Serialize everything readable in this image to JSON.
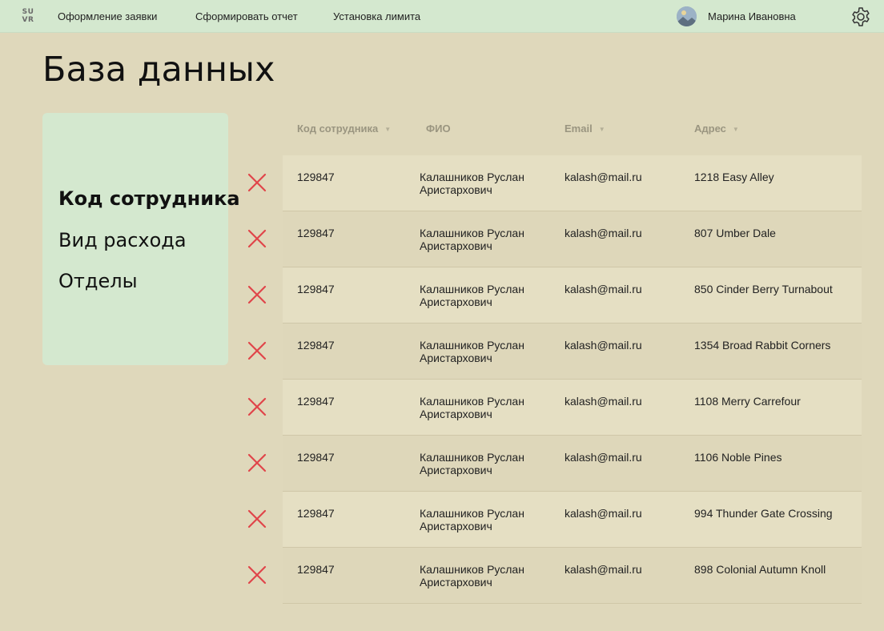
{
  "app": {
    "logo_text_top": "SU",
    "logo_text_bottom": "VR"
  },
  "nav": {
    "items": [
      {
        "label": "Оформление заявки"
      },
      {
        "label": "Сформировать отчет"
      },
      {
        "label": "Установка лимита"
      }
    ],
    "user_name": "Марина Ивановна"
  },
  "page_title": "База данных",
  "sidebar": {
    "items": [
      {
        "label": "Код сотрудника",
        "active": true
      },
      {
        "label": "Вид расхода",
        "active": false
      },
      {
        "label": "Отделы",
        "active": false
      }
    ]
  },
  "table": {
    "columns": [
      {
        "label": "Код сотрудника"
      },
      {
        "label": "ФИО"
      },
      {
        "label": "Email"
      },
      {
        "label": "Адрес"
      }
    ],
    "rows": [
      {
        "id": "129847",
        "name_line1": "Калашников Руслан",
        "name_line2": "Аристархович",
        "email": "kalash@mail.ru",
        "address": "1218 Easy Alley"
      },
      {
        "id": "129847",
        "name_line1": "Калашников Руслан",
        "name_line2": "Аристархович",
        "email": "kalash@mail.ru",
        "address": "807 Umber Dale"
      },
      {
        "id": "129847",
        "name_line1": "Калашников Руслан",
        "name_line2": "Аристархович",
        "email": "kalash@mail.ru",
        "address": "850 Cinder Berry Turnabout"
      },
      {
        "id": "129847",
        "name_line1": "Калашников Руслан",
        "name_line2": "Аристархович",
        "email": "kalash@mail.ru",
        "address": "1354 Broad Rabbit Corners"
      },
      {
        "id": "129847",
        "name_line1": "Калашников Руслан",
        "name_line2": "Аристархович",
        "email": "kalash@mail.ru",
        "address": "1108 Merry Carrefour"
      },
      {
        "id": "129847",
        "name_line1": "Калашников Руслан",
        "name_line2": "Аристархович",
        "email": "kalash@mail.ru",
        "address": "1106 Noble Pines"
      },
      {
        "id": "129847",
        "name_line1": "Калашников Руслан",
        "name_line2": "Аристархович",
        "email": "kalash@mail.ru",
        "address": "994 Thunder Gate Crossing"
      },
      {
        "id": "129847",
        "name_line1": "Калашников Руслан",
        "name_line2": "Аристархович",
        "email": "kalash@mail.ru",
        "address": "898 Colonial Autumn Knoll"
      }
    ]
  },
  "icons": {
    "delete": "close-icon",
    "settings": "gear-icon",
    "sort": "chevron-down-icon"
  },
  "colors": {
    "topbar": "#d4e8cf",
    "background": "#dfd8bb",
    "panel": "#d4e8cf",
    "delete_icon": "#e0454a"
  }
}
